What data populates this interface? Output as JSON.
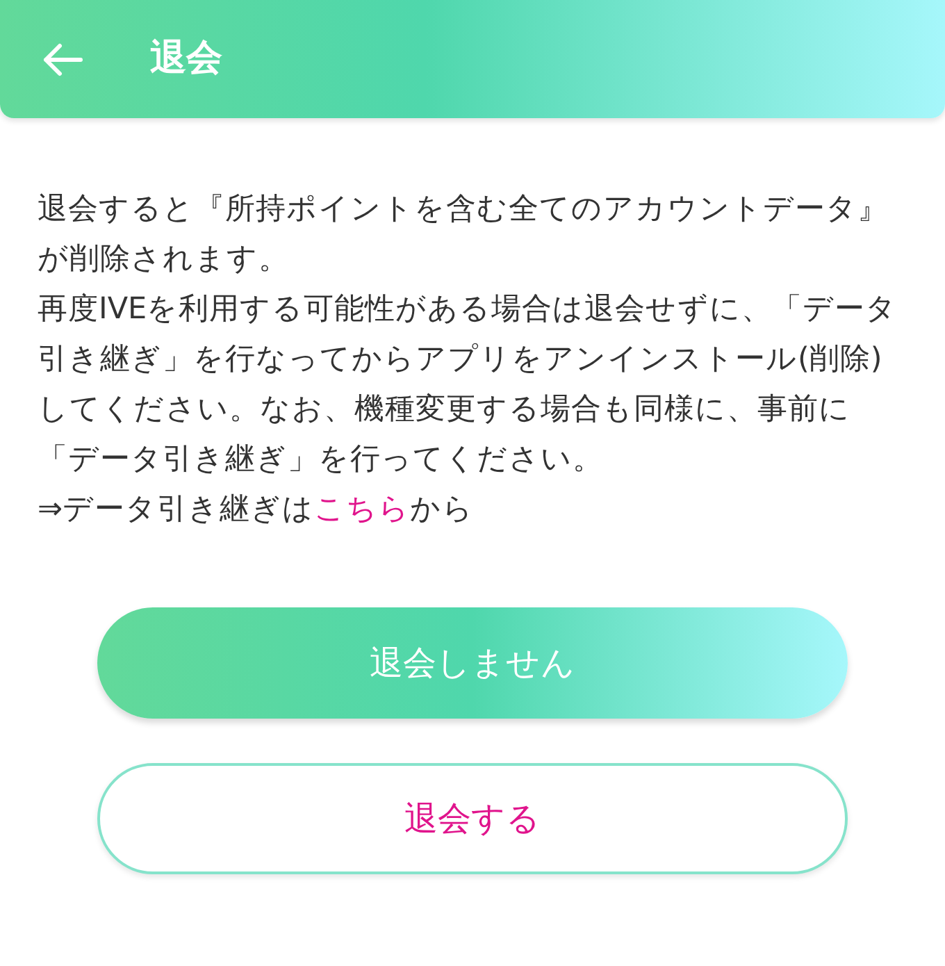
{
  "header": {
    "title": "退会"
  },
  "paragraphs": [
    "退会すると『所持ポイントを含む全てのアカウントデータ』が削除されます。",
    "再度IVEを利用する可能性がある場合は退会せずに、「データ引き継ぎ」を行なってからアプリをアンインストール(削除)してください。なお、機種変更する場合も同様に、事前に「データ引き継ぎ」を行ってください。"
  ],
  "transfer_line": {
    "before": "⇒データ引き継ぎは",
    "link": "こちら",
    "after": "から"
  },
  "buttons": [
    {
      "kind": "primary",
      "label": "退会しません"
    },
    {
      "kind": "outline",
      "label": "退会する"
    }
  ]
}
